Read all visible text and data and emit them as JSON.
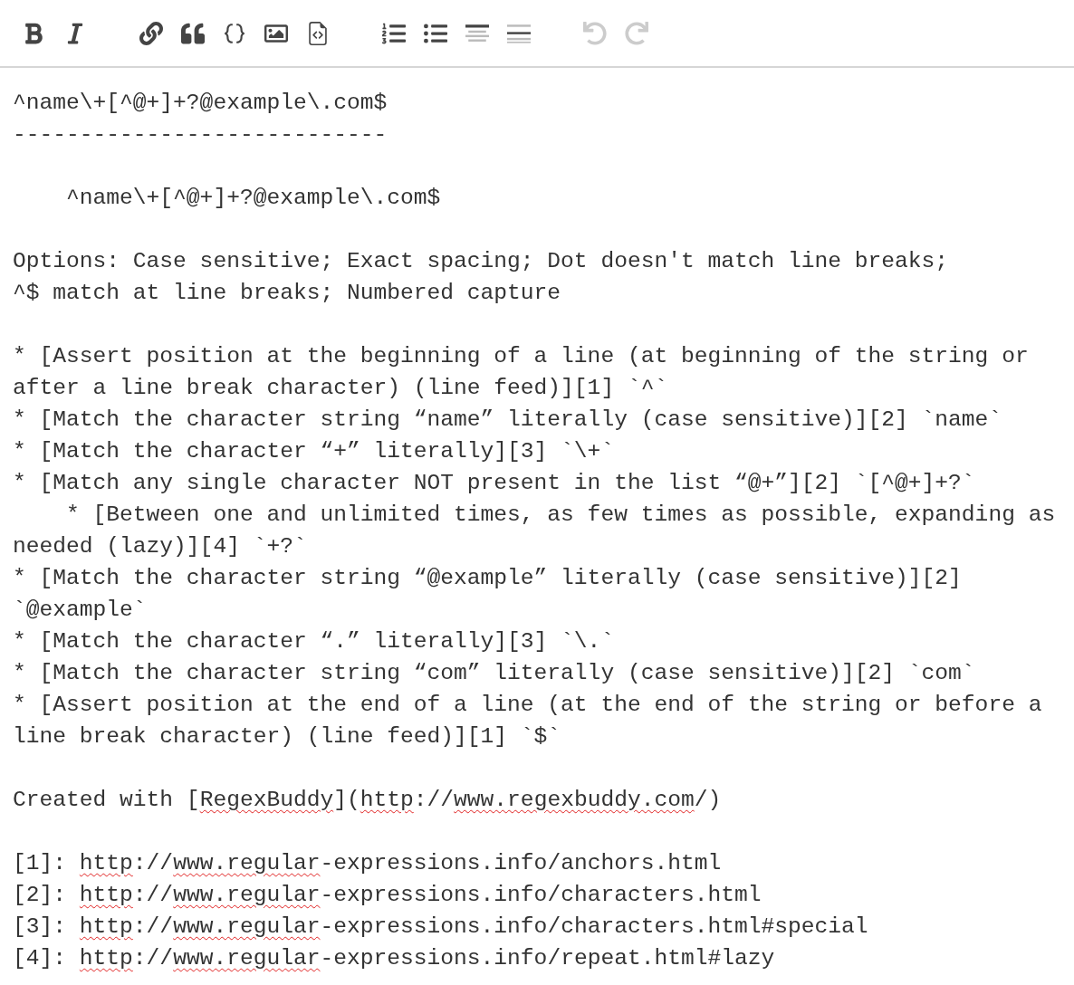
{
  "toolbar": {
    "groups": [
      [
        {
          "kind": "bold",
          "disabled": false
        },
        {
          "kind": "italic",
          "disabled": false
        }
      ],
      [
        {
          "kind": "link",
          "disabled": false
        },
        {
          "kind": "quote",
          "disabled": false
        },
        {
          "kind": "code",
          "disabled": false
        },
        {
          "kind": "image",
          "disabled": false
        },
        {
          "kind": "snippet",
          "disabled": false
        }
      ],
      [
        {
          "kind": "ordered-list",
          "disabled": false
        },
        {
          "kind": "bullet-list",
          "disabled": false
        },
        {
          "kind": "heading",
          "disabled": false
        },
        {
          "kind": "rule",
          "disabled": false
        }
      ],
      [
        {
          "kind": "undo",
          "disabled": true
        },
        {
          "kind": "redo",
          "disabled": true
        }
      ]
    ]
  },
  "editor": {
    "lines": [
      {
        "kind": "plain",
        "text": "^name\\+[^@+]+?@example\\.com$"
      },
      {
        "kind": "plain",
        "text": "----------------------------"
      },
      {
        "kind": "blank"
      },
      {
        "kind": "plain",
        "text": "    ^name\\+[^@+]+?@example\\.com$"
      },
      {
        "kind": "blank"
      },
      {
        "kind": "plain",
        "text": "Options: Case sensitive; Exact spacing; Dot doesn't match line breaks;"
      },
      {
        "kind": "plain",
        "text": "^$ match at line breaks; Numbered capture"
      },
      {
        "kind": "blank"
      },
      {
        "kind": "plain",
        "text": "* [Assert position at the beginning of a line (at beginning of the string or"
      },
      {
        "kind": "plain",
        "text": "after a line break character) (line feed)][1] `^`"
      },
      {
        "kind": "plain",
        "text": "* [Match the character string “name” literally (case sensitive)][2] `name`"
      },
      {
        "kind": "plain",
        "text": "* [Match the character “+” literally][3] `\\+`"
      },
      {
        "kind": "plain",
        "text": "* [Match any single character NOT present in the list “@+”][2] `[^@+]+?`"
      },
      {
        "kind": "plain",
        "text": "    * [Between one and unlimited times, as few times as possible, expanding as"
      },
      {
        "kind": "plain",
        "text": "needed (lazy)][4] `+?`"
      },
      {
        "kind": "plain",
        "text": "* [Match the character string “@example” literally (case sensitive)][2]"
      },
      {
        "kind": "plain",
        "text": "`@example`"
      },
      {
        "kind": "plain",
        "text": "* [Match the character “.” literally][3] `\\.`"
      },
      {
        "kind": "plain",
        "text": "* [Match the character string “com” literally (case sensitive)][2] `com`"
      },
      {
        "kind": "plain",
        "text": "* [Assert position at the end of a line (at the end of the string or before a"
      },
      {
        "kind": "plain",
        "text": "line break character) (line feed)][1] `$`"
      },
      {
        "kind": "blank"
      },
      {
        "kind": "spellchecked",
        "parts": [
          {
            "text": "Created with [",
            "misspelled": false
          },
          {
            "text": "RegexBuddy",
            "misspelled": true
          },
          {
            "text": "](",
            "misspelled": false
          },
          {
            "text": "http",
            "misspelled": true
          },
          {
            "text": "://",
            "misspelled": false
          },
          {
            "text": "www.regexbuddy.com",
            "misspelled": true
          },
          {
            "text": "/)",
            "misspelled": false
          }
        ]
      },
      {
        "kind": "blank"
      },
      {
        "kind": "spellchecked",
        "parts": [
          {
            "text": "[1]: ",
            "misspelled": false
          },
          {
            "text": "http",
            "misspelled": true
          },
          {
            "text": "://",
            "misspelled": false
          },
          {
            "text": "www.regular",
            "misspelled": true
          },
          {
            "text": "-expressions.info/anchors.html",
            "misspelled": false
          }
        ]
      },
      {
        "kind": "spellchecked",
        "parts": [
          {
            "text": "[2]: ",
            "misspelled": false
          },
          {
            "text": "http",
            "misspelled": true
          },
          {
            "text": "://",
            "misspelled": false
          },
          {
            "text": "www.regular",
            "misspelled": true
          },
          {
            "text": "-expressions.info/characters.html",
            "misspelled": false
          }
        ]
      },
      {
        "kind": "spellchecked",
        "parts": [
          {
            "text": "[3]: ",
            "misspelled": false
          },
          {
            "text": "http",
            "misspelled": true
          },
          {
            "text": "://",
            "misspelled": false
          },
          {
            "text": "www.regular",
            "misspelled": true
          },
          {
            "text": "-expressions.info/characters.html#special",
            "misspelled": false
          }
        ]
      },
      {
        "kind": "spellchecked",
        "parts": [
          {
            "text": "[4]: ",
            "misspelled": false
          },
          {
            "text": "http",
            "misspelled": true
          },
          {
            "text": "://",
            "misspelled": false
          },
          {
            "text": "www.regular",
            "misspelled": true
          },
          {
            "text": "-expressions.info/repeat.html#lazy",
            "misspelled": false
          }
        ]
      }
    ]
  }
}
